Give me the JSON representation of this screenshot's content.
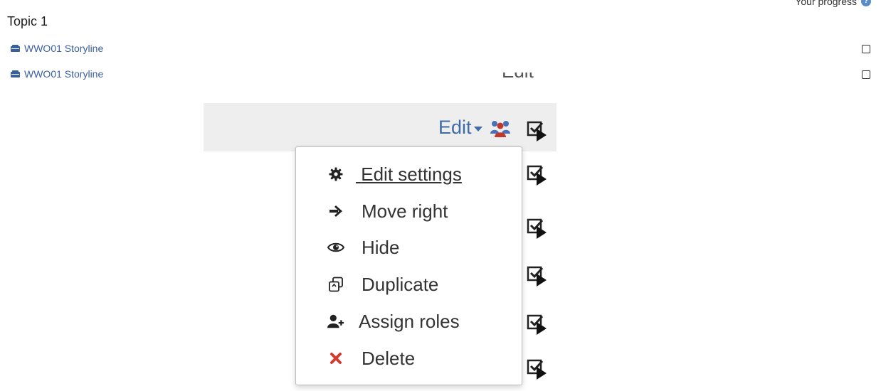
{
  "header": {
    "topic_title": "Topic 1",
    "progress_label": "Your progress",
    "help_icon": "info-icon"
  },
  "activities": [
    {
      "label": "WWO01 Storyline",
      "icon": "scorm-package-icon",
      "completed": false
    },
    {
      "label": "WWO01 Storyline",
      "icon": "scorm-package-icon",
      "completed": false
    }
  ],
  "cut_off_label": "Edit",
  "action_menu": {
    "trigger_label": "Edit",
    "groups_icon": "groups-icon",
    "items": [
      {
        "label": "Edit settings",
        "icon": "gear-icon"
      },
      {
        "label": "Move right",
        "icon": "arrow-right-icon"
      },
      {
        "label": "Hide",
        "icon": "eye-icon"
      },
      {
        "label": "Duplicate",
        "icon": "duplicate-icon"
      },
      {
        "label": "Assign roles",
        "icon": "assign-roles-icon"
      },
      {
        "label": "Delete",
        "icon": "delete-icon"
      }
    ]
  },
  "colors": {
    "link": "#3a5f9f",
    "edit_trigger": "#3e6aa6",
    "row_highlight": "#eeeeee",
    "delete_icon": "#d23b2f",
    "groups_icon_blue": "#4b6fb8",
    "groups_icon_red": "#c0392b"
  }
}
